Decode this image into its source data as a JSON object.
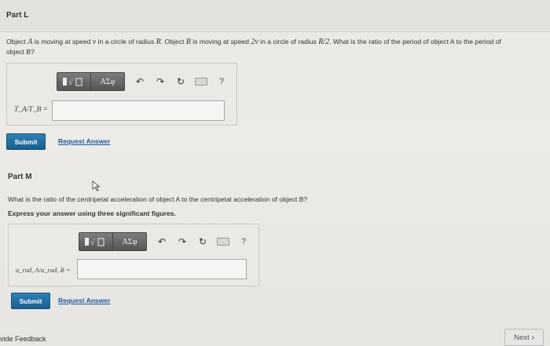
{
  "part_l": {
    "title": "Part L",
    "question_1": "Object ",
    "obj_a": "A",
    "question_2": " is moving at speed ",
    "v": "v",
    "question_3": " in a circle of radius ",
    "R": "R",
    "question_4": ". Object ",
    "obj_b": "B",
    "question_5": " is moving at speed ",
    "v2": "2v",
    "question_6": " in a circle of radius ",
    "R2": "R/2",
    "question_7": ". What is the ratio of the period of object A to the period of",
    "question_line2": "object B?",
    "answer_label": "T_A/T_B =",
    "submit_label": "Submit",
    "request_label": "Request Answer"
  },
  "part_m": {
    "title": "Part M",
    "question": "What is the ratio of the centripetal acceleration of object A to the centripetal acceleration of object B?",
    "instruction": "Express your answer using three significant figures.",
    "answer_label": "a_rad, A/a_rad, B =",
    "submit_label": "Submit",
    "request_label": "Request Answer"
  },
  "toolbar": {
    "greek_label": "ΑΣφ",
    "help_label": "?",
    "icons": [
      "templates-icon",
      "greek-icon",
      "undo-icon",
      "redo-icon",
      "reset-icon",
      "keyboard-icon",
      "help-icon"
    ]
  },
  "footer": {
    "feedback_label": "vide Feedback",
    "next_label": "Next"
  }
}
